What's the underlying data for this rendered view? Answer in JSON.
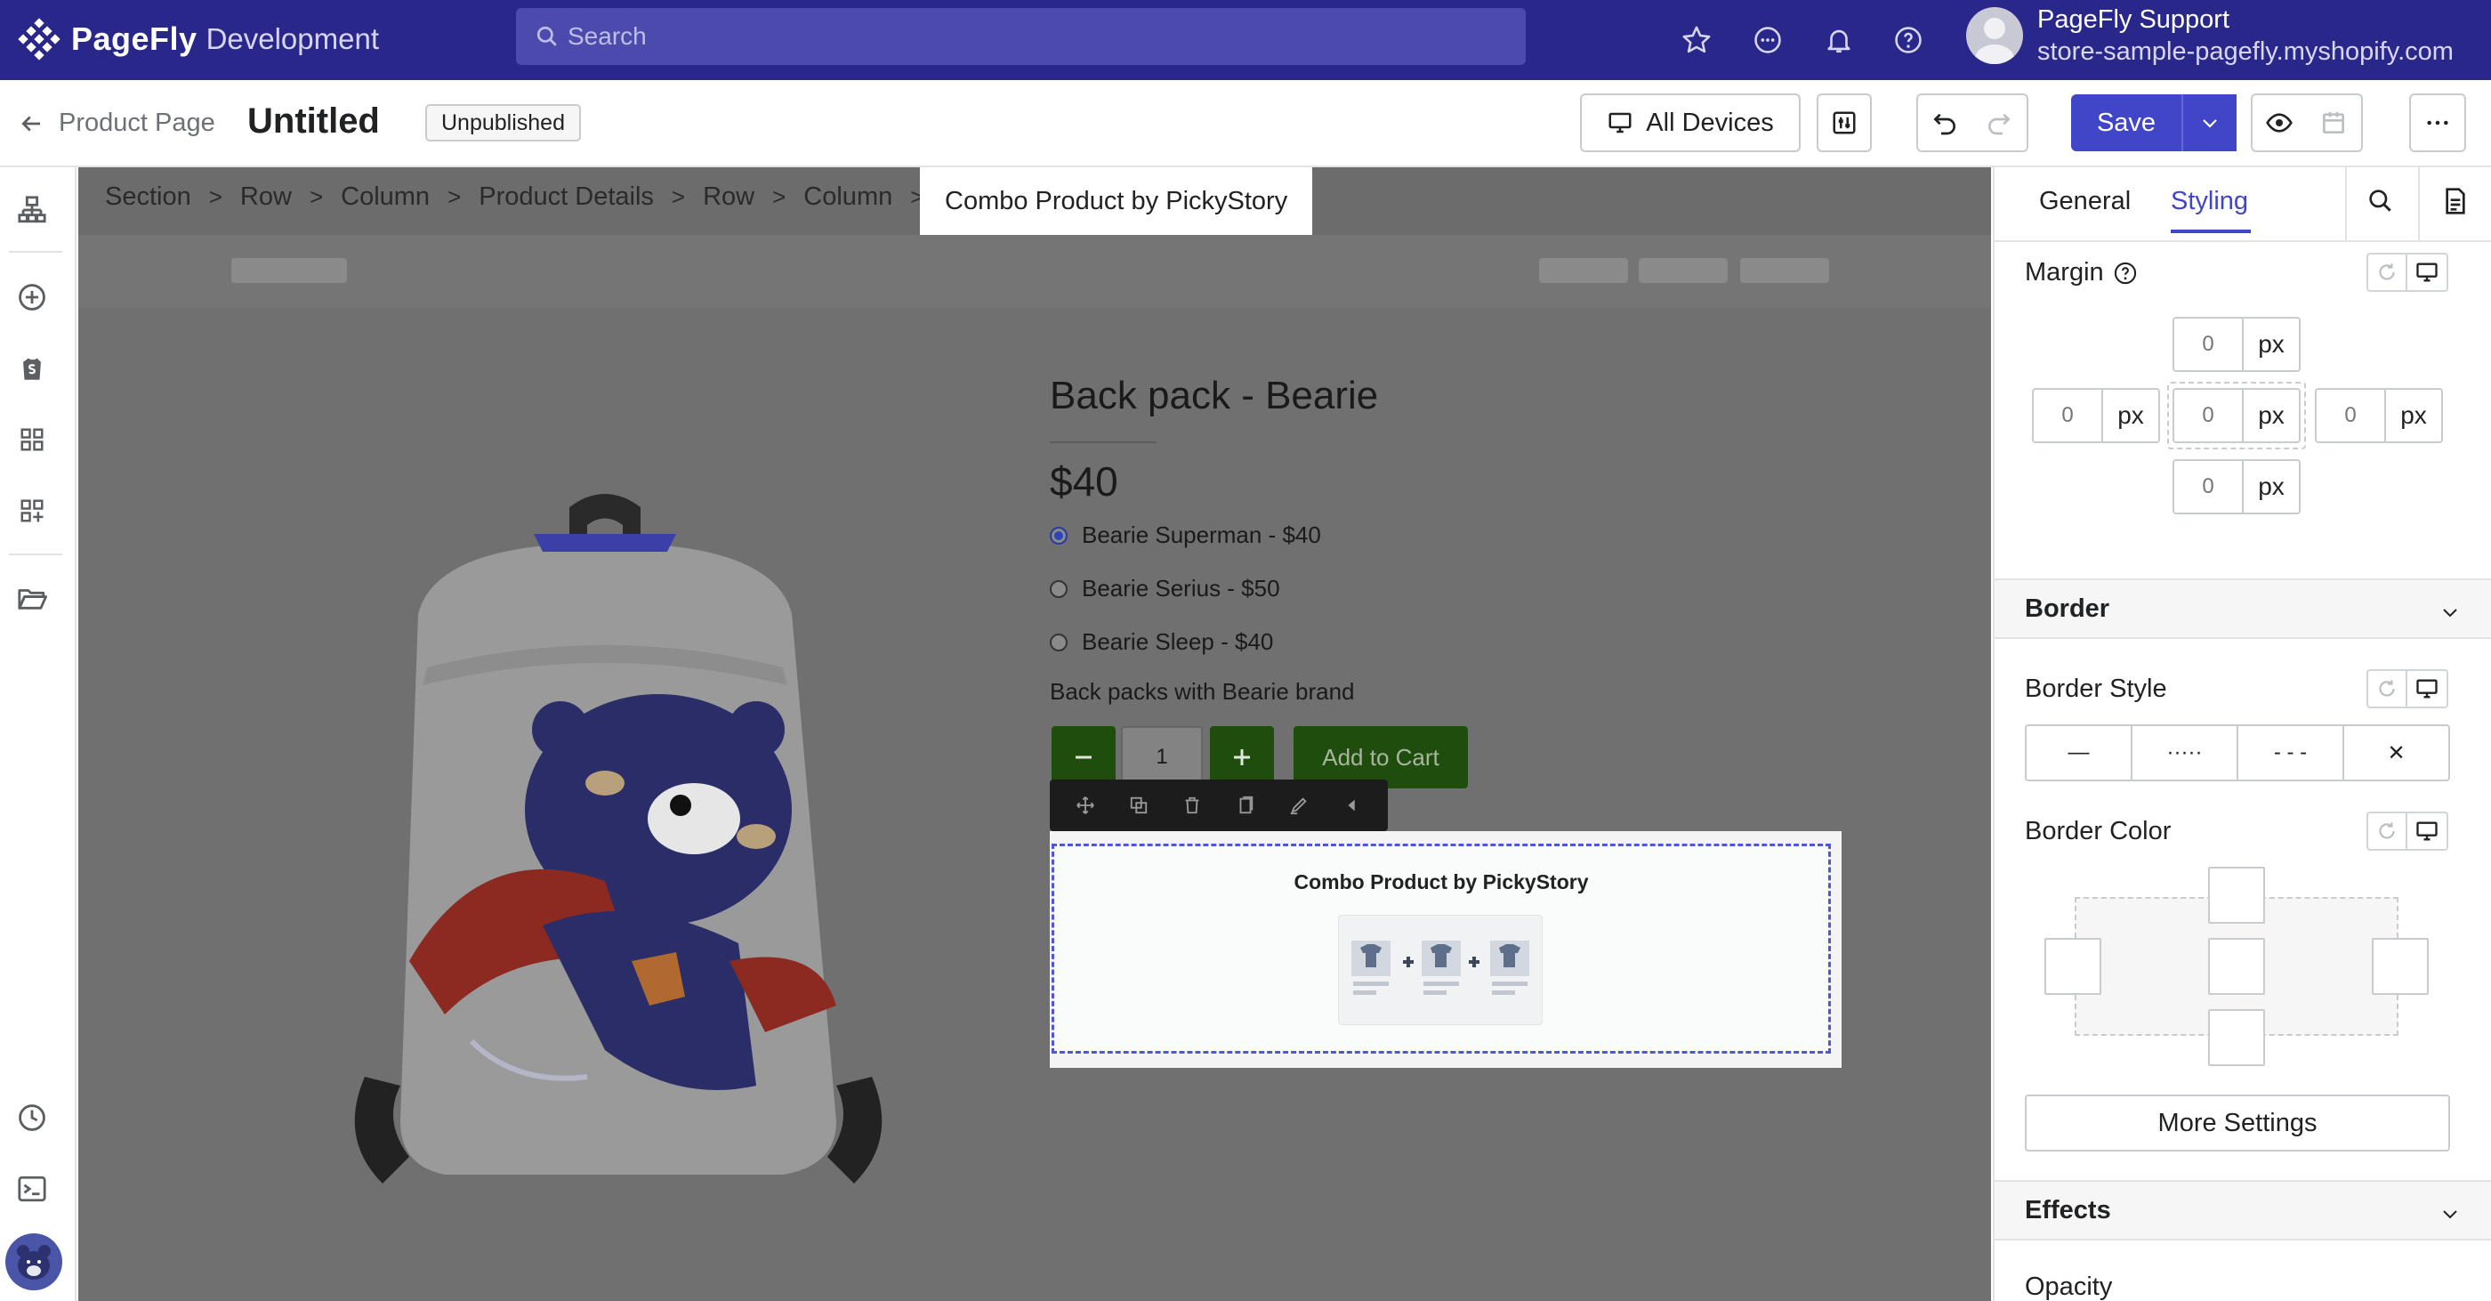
{
  "app": {
    "brand": "PageFly",
    "env": "Development",
    "search_placeholder": "Search"
  },
  "account": {
    "name": "PageFly Support",
    "store": "store-sample-pagefly.myshopify.com"
  },
  "toolbar": {
    "back_label": "Product Page",
    "page_title": "Untitled",
    "status": "Unpublished",
    "devices_label": "All Devices",
    "save_label": "Save"
  },
  "breadcrumb": {
    "items": [
      "Section",
      "Row",
      "Column",
      "Product Details",
      "Row",
      "Column"
    ],
    "active": "Combo Product by PickyStory"
  },
  "product": {
    "title": "Back pack - Bearie",
    "price": "$40",
    "options": [
      "Bearie Superman - $40",
      "Bearie Serius - $50",
      "Bearie Sleep - $40"
    ],
    "selected_option": 0,
    "description": "Back packs with Bearie brand",
    "quantity": "1",
    "add_to_cart": "Add to Cart",
    "combo_title": "Combo Product by PickyStory"
  },
  "panel": {
    "tabs": [
      "General",
      "Styling"
    ],
    "active_tab": "Styling",
    "margin_label": "Margin",
    "margin": {
      "top": "0",
      "left": "0",
      "center": "0",
      "right": "0",
      "bottom": "0",
      "unit": "px"
    },
    "border_section": "Border",
    "border_style_label": "Border Style",
    "border_style_options": [
      "—",
      "·····",
      "- - -",
      "✕"
    ],
    "border_color_label": "Border Color",
    "more_settings": "More Settings",
    "effects_section": "Effects",
    "opacity_label": "Opacity"
  },
  "colors": {
    "topbar": "#29288a",
    "accent": "#4145c8",
    "add_to_cart": "#1f4d0e"
  }
}
